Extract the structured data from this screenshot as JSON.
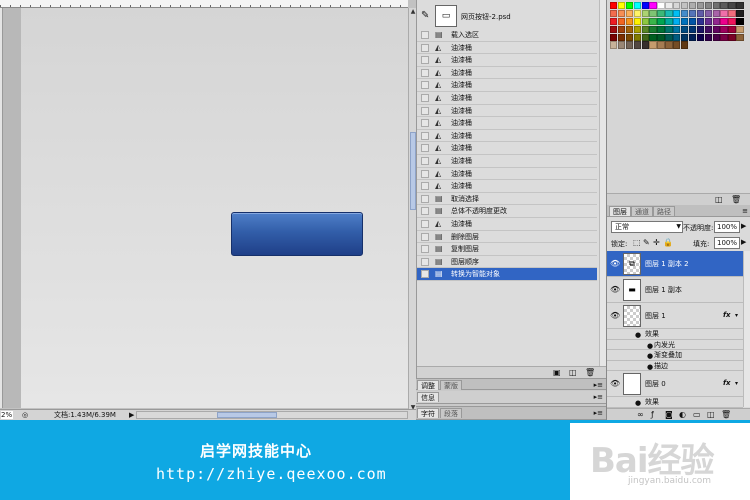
{
  "canvas": {
    "zoom": "2%",
    "doc_size": "文档:1.43M/6.39M"
  },
  "history": {
    "document": "网页按钮-2.psd",
    "items": [
      {
        "label": "载入选区",
        "icon": "page"
      },
      {
        "label": "油漆桶",
        "icon": "bucket"
      },
      {
        "label": "油漆桶",
        "icon": "bucket"
      },
      {
        "label": "油漆桶",
        "icon": "bucket"
      },
      {
        "label": "油漆桶",
        "icon": "bucket"
      },
      {
        "label": "油漆桶",
        "icon": "bucket"
      },
      {
        "label": "油漆桶",
        "icon": "bucket"
      },
      {
        "label": "油漆桶",
        "icon": "bucket"
      },
      {
        "label": "油漆桶",
        "icon": "bucket"
      },
      {
        "label": "油漆桶",
        "icon": "bucket"
      },
      {
        "label": "油漆桶",
        "icon": "bucket"
      },
      {
        "label": "油漆桶",
        "icon": "bucket"
      },
      {
        "label": "油漆桶",
        "icon": "bucket"
      },
      {
        "label": "取消选择",
        "icon": "page"
      },
      {
        "label": "总体不透明度更改",
        "icon": "page"
      },
      {
        "label": "油漆桶",
        "icon": "bucket"
      },
      {
        "label": "删除图层",
        "icon": "page"
      },
      {
        "label": "复制图层",
        "icon": "page"
      },
      {
        "label": "图层顺序",
        "icon": "page"
      },
      {
        "label": "转换为智能对象",
        "icon": "page",
        "selected": true
      }
    ]
  },
  "lower_tabs": {
    "adjust": [
      "调整",
      "蒙版"
    ],
    "info": [
      "信息"
    ],
    "char": [
      "字符",
      "段落"
    ]
  },
  "swatch_colors": [
    "#ff0000",
    "#ffff00",
    "#00ff00",
    "#00ffff",
    "#0000ff",
    "#ff00ff",
    "#ffffff",
    "#ebebeb",
    "#d6d6d6",
    "#c2c2c2",
    "#adadad",
    "#999999",
    "#858585",
    "#707070",
    "#5c5c5c",
    "#474747",
    "#333333",
    "#f26c4f",
    "#f68e55",
    "#fbaf5c",
    "#fff467",
    "#acd372",
    "#7dc473",
    "#3cb878",
    "#1cbbb4",
    "#00bff3",
    "#448ccb",
    "#5574b9",
    "#605ca8",
    "#855fa8",
    "#a763a8",
    "#f06ea9",
    "#f26d7d",
    "#1f1f1f",
    "#ed1c24",
    "#f26522",
    "#f7941d",
    "#fff200",
    "#8dc63f",
    "#39b54a",
    "#00a651",
    "#00a99d",
    "#00aeef",
    "#0072bc",
    "#0054a6",
    "#2e3192",
    "#662d91",
    "#92278f",
    "#ec008c",
    "#ed145b",
    "#000000",
    "#9e0b0f",
    "#a0410d",
    "#a3620a",
    "#aba000",
    "#598527",
    "#197b30",
    "#007236",
    "#00746b",
    "#0076a3",
    "#004b80",
    "#003471",
    "#1b1464",
    "#440e62",
    "#630460",
    "#9e005d",
    "#9e0039",
    "#c69c6d",
    "#790000",
    "#7b2e00",
    "#7d4900",
    "#827b00",
    "#406618",
    "#005e20",
    "#005826",
    "#005952",
    "#005b7f",
    "#003663",
    "#002157",
    "#0d004c",
    "#32004b",
    "#4b0049",
    "#7b0046",
    "#7a0026",
    "#8c6239",
    "#c7b299",
    "#998675",
    "#736357",
    "#534741",
    "#362f2d",
    "#c69c6d",
    "#a67c52",
    "#8c6239",
    "#754c24",
    "#603913"
  ],
  "layers": {
    "tabs": [
      "图层",
      "通道",
      "路径"
    ],
    "blend_mode": "正常",
    "opacity_label": "不透明度:",
    "opacity_value": "100%",
    "lock_label": "锁定:",
    "fill_label": "填充:",
    "fill_value": "100%",
    "items": {
      "layer1_copy2": "图层 1 副本 2",
      "layer1_copy": "图层 1 副本",
      "layer1": "图层 1",
      "effects": "效果",
      "inner_glow": "内发光",
      "gradient_overlay": "渐变叠加",
      "stroke": "描边",
      "layer0": "图层 0",
      "layer0_effects": "效果"
    },
    "fx": "fx"
  },
  "banner": {
    "title": "启学网技能中心",
    "url": "http://zhiye.qeexoo.com",
    "watermark_logo": "Bai经验",
    "watermark_url": "jingyan.baidu.com"
  }
}
